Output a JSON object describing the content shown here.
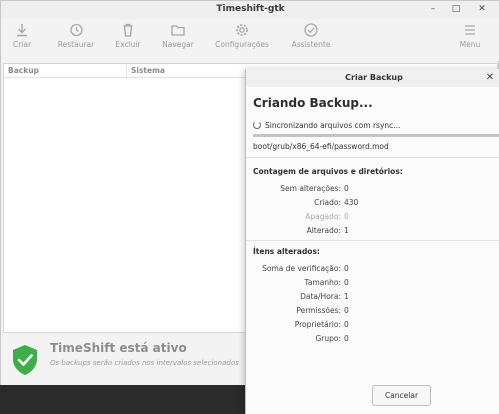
{
  "window": {
    "title": "Timeshift-gtk",
    "controls": {
      "minimize": "–",
      "maximize": "□",
      "close": "✕"
    }
  },
  "toolbar": {
    "items": [
      {
        "label": "Criar",
        "icon": "download-icon"
      },
      {
        "label": "Restaurar",
        "icon": "history-icon"
      },
      {
        "label": "Excluir",
        "icon": "trash-icon"
      },
      {
        "label": "Navegar",
        "icon": "folder-icon"
      },
      {
        "label": "Configurações",
        "icon": "gear-icon"
      },
      {
        "label": "Assistente",
        "icon": "check-circle-icon"
      },
      {
        "label": "Menu",
        "icon": "hamburger-icon"
      }
    ]
  },
  "snapshot_list": {
    "columns": [
      "Backup",
      "Sistema"
    ]
  },
  "status": {
    "title": "TimeShift está ativo",
    "subtitle": "Os backups serão criados nos intervalos selecionados",
    "shield_color": "#3fae49"
  },
  "dialog": {
    "title": "Criar Backup",
    "close": "✕",
    "heading": "Criando Backup...",
    "status_text": "Sincronizando arquivos com rsync...",
    "current_file": "boot/grub/x86_64-efi/password.mod",
    "counts_title": "Contagem de arquivos e diretórios:",
    "counts": [
      {
        "label": "Sem alterações:",
        "value": "0",
        "dim": false
      },
      {
        "label": "Criado:",
        "value": "430",
        "dim": false
      },
      {
        "label": "Apagado:",
        "value": "0",
        "dim": true
      },
      {
        "label": "Alterado:",
        "value": "1",
        "dim": false
      }
    ],
    "changed_title": "Ítens alterados:",
    "changed": [
      {
        "label": "Soma de verificação:",
        "value": "0"
      },
      {
        "label": "Tamanho:",
        "value": "0"
      },
      {
        "label": "Data/Hora:",
        "value": "1"
      },
      {
        "label": "Permissões:",
        "value": "0"
      },
      {
        "label": "Proprietário:",
        "value": "0"
      },
      {
        "label": "Grupo:",
        "value": "0"
      }
    ],
    "cancel_label": "Cancelar"
  }
}
